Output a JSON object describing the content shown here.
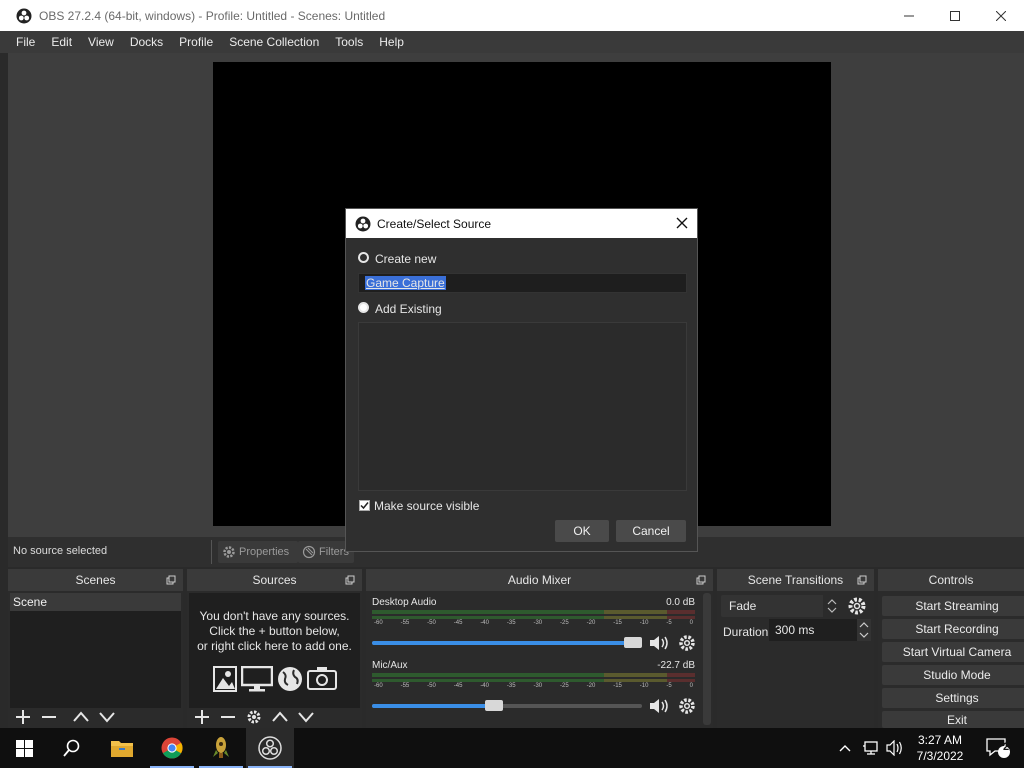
{
  "window": {
    "title": "OBS 27.2.4 (64-bit, windows) - Profile: Untitled - Scenes: Untitled"
  },
  "menu": [
    "File",
    "Edit",
    "View",
    "Docks",
    "Profile",
    "Scene Collection",
    "Tools",
    "Help"
  ],
  "status": {
    "no_source": "No source selected",
    "properties": "Properties",
    "filters": "Filters"
  },
  "docks": {
    "scenes": {
      "title": "Scenes",
      "items": [
        "Scene"
      ]
    },
    "sources": {
      "title": "Sources",
      "empty_line1": "You don't have any sources.",
      "empty_line2": "Click the + button below,",
      "empty_line3": "or right click here to add one."
    },
    "mixer": {
      "title": "Audio Mixer",
      "ticks": [
        "-60",
        "-55",
        "-50",
        "-45",
        "-40",
        "-35",
        "-30",
        "-25",
        "-20",
        "-15",
        "-10",
        "-5",
        "0"
      ],
      "channels": [
        {
          "name": "Desktop Audio",
          "db": "0.0 dB",
          "level": 1.0
        },
        {
          "name": "Mic/Aux",
          "db": "-22.7 dB",
          "level": 0.45
        }
      ]
    },
    "transitions": {
      "title": "Scene Transitions",
      "selected": "Fade",
      "duration_label": "Duration",
      "duration": "300 ms"
    },
    "controls": {
      "title": "Controls",
      "buttons": [
        "Start Streaming",
        "Start Recording",
        "Start Virtual Camera",
        "Studio Mode",
        "Settings",
        "Exit"
      ]
    }
  },
  "dialog": {
    "title": "Create/Select Source",
    "create_new": "Create new",
    "name_value": "Game Capture",
    "add_existing": "Add Existing",
    "make_visible": "Make source visible",
    "ok": "OK",
    "cancel": "Cancel"
  },
  "taskbar": {
    "time": "3:27 AM",
    "date": "7/3/2022",
    "notification_count": "2"
  },
  "colors": {
    "accent": "#3a8ee6",
    "selection": "#3a6fd8"
  }
}
